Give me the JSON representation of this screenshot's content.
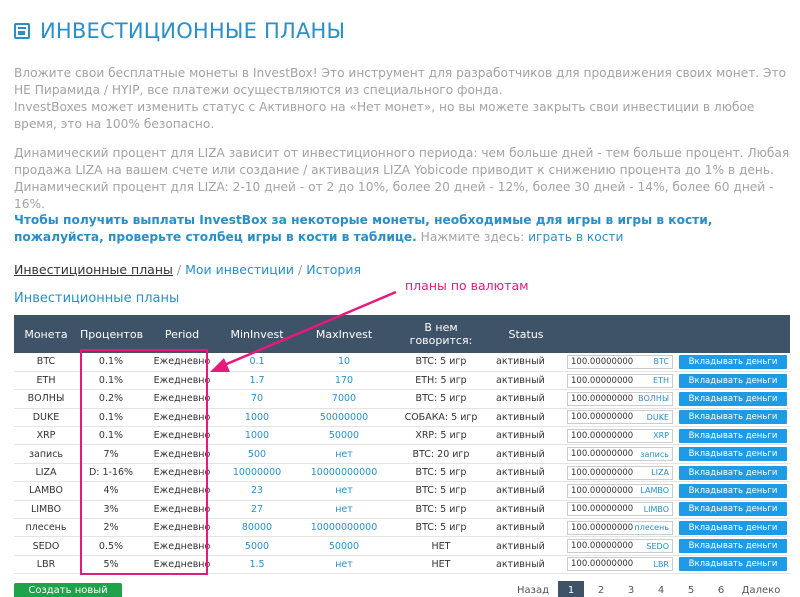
{
  "page": {
    "title": "ИНВЕСТИЦИОННЫЕ ПЛАНЫ",
    "intro1": "Вложите свои бесплатные монеты в InvestBox! Это инструмент для разработчиков для продвижения своих монет. Это НЕ Пирамида / HYIP, все платежи осуществляются из специального фонда.",
    "intro2": "InvestBoxes может изменить статус с Активного на «Нет монет», но вы можете закрыть свои инвестиции в любое время, это на 100% безопасно.",
    "dynamic1": "Динамический процент для LIZA зависит от инвестиционного периода: чем больше дней - тем больше процент. Любая продажа LIZA на вашем счете или создание / активация LIZA Yobicode приводит к снижению процента до 1% в день.",
    "dynamic2": "Динамический процент для LIZA: 2-10 дней - от 2 до 10%, более 20 дней - 12%, более 30 дней - 14%, более 60 дней - 16%.",
    "dice_bold": "Чтобы получить выплаты InvestBox за некоторые монеты, необходимые для игры в игры в кости, пожалуйста, проверьте столбец игры в кости в таблице.",
    "dice_normal": " Нажмите здесь: ",
    "dice_link": "играть в кости"
  },
  "breadcrumb": {
    "item1": "Инвестиционные планы",
    "sep": "/",
    "item2": "Мои инвестиции",
    "item3": "История"
  },
  "annotation": "планы по валютам",
  "section_title": "Инвестиционные планы",
  "table": {
    "headers": {
      "coin": "Монета",
      "percent": "Процентов",
      "period": "Period",
      "min": "MinInvest",
      "max": "MaxInvest",
      "says": "В нем говорится:",
      "status": "Status"
    },
    "rows": [
      {
        "coin": "BTC",
        "pct": "0.1%",
        "period": "Ежедневно",
        "min": "0.1",
        "max": "10",
        "says": "BTC: 5 игр",
        "status": "активный",
        "amount": "100.00000000",
        "cur": "BTC",
        "btn": "Вкладывать деньги"
      },
      {
        "coin": "ETH",
        "pct": "0.1%",
        "period": "Ежедневно",
        "min": "1.7",
        "max": "170",
        "says": "ETH: 5 игр",
        "status": "активный",
        "amount": "100.00000000",
        "cur": "ETH",
        "btn": "Вкладывать деньги"
      },
      {
        "coin": "ВОЛНЫ",
        "pct": "0.2%",
        "period": "Ежедневно",
        "min": "70",
        "max": "7000",
        "says": "BTC: 5 игр",
        "status": "активный",
        "amount": "100.00000000",
        "cur": "ВОЛНЫ",
        "btn": "Вкладывать деньги"
      },
      {
        "coin": "DUKE",
        "pct": "0.1%",
        "period": "Ежедневно",
        "min": "1000",
        "max": "50000000",
        "says": "СОБАКА: 5 игр",
        "status": "активный",
        "amount": "100.00000000",
        "cur": "DUKE",
        "btn": "Вкладывать деньги"
      },
      {
        "coin": "XRP",
        "pct": "0.1%",
        "period": "Ежедневно",
        "min": "1000",
        "max": "50000",
        "says": "XRP: 5 игр",
        "status": "активный",
        "amount": "100.00000000",
        "cur": "XRP",
        "btn": "Вкладывать деньги"
      },
      {
        "coin": "запись",
        "pct": "7%",
        "period": "Ежедневно",
        "min": "500",
        "max": "нет",
        "says": "BTC: 20 игр",
        "status": "активный",
        "amount": "100.00000000",
        "cur": "запись",
        "btn": "Вкладывать деньги"
      },
      {
        "coin": "LIZA",
        "pct": "D: 1-16%",
        "period": "Ежедневно",
        "min": "10000000",
        "max": "10000000000",
        "says": "BTC: 5 игр",
        "status": "активный",
        "amount": "100.00000000",
        "cur": "LIZA",
        "btn": "Вкладывать деньги"
      },
      {
        "coin": "LAMBO",
        "pct": "4%",
        "period": "Ежедневно",
        "min": "23",
        "max": "нет",
        "says": "BTC: 5 игр",
        "status": "активный",
        "amount": "100.00000000",
        "cur": "LAMBO",
        "btn": "Вкладывать деньги"
      },
      {
        "coin": "LIMBO",
        "pct": "3%",
        "period": "Ежедневно",
        "min": "27",
        "max": "нет",
        "says": "BTC: 5 игр",
        "status": "активный",
        "amount": "100.00000000",
        "cur": "LIMBO",
        "btn": "Вкладывать деньги"
      },
      {
        "coin": "плесень",
        "pct": "2%",
        "period": "Ежедневно",
        "min": "80000",
        "max": "10000000000",
        "says": "BTC: 5 игр",
        "status": "активный",
        "amount": "100.00000000",
        "cur": "плесень",
        "btn": "Вкладывать деньги"
      },
      {
        "coin": "SEDO",
        "pct": "0.5%",
        "period": "Ежедневно",
        "min": "5000",
        "max": "50000",
        "says": "HET",
        "status": "активный",
        "amount": "100.00000000",
        "cur": "SEDO",
        "btn": "Вкладывать деньги"
      },
      {
        "coin": "LBR",
        "pct": "5%",
        "period": "Ежедневно",
        "min": "1.5",
        "max": "нет",
        "says": "HET",
        "status": "активный",
        "amount": "100.00000000",
        "cur": "LBR",
        "btn": "Вкладывать деньги"
      }
    ]
  },
  "create_button": "Создать новый план",
  "pagination": {
    "prev": "Назад",
    "pages": [
      "1",
      "2",
      "3",
      "4",
      "5",
      "6"
    ],
    "next": "Далеко"
  },
  "colors": {
    "accent": "#2a8fc7",
    "header_bg": "#3e5367",
    "annotation": "#e8197a",
    "create_button": "#1fa34a",
    "invest_button": "#1e9be6"
  }
}
